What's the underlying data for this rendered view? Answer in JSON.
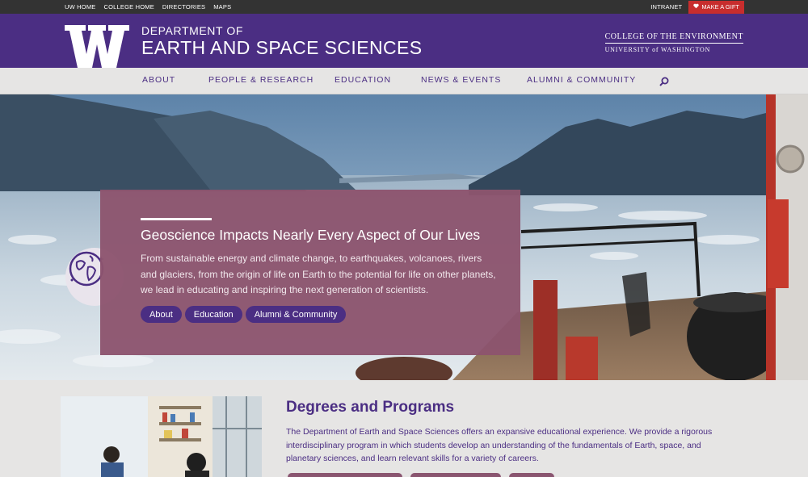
{
  "utility": {
    "links": [
      "UW HOME",
      "COLLEGE HOME",
      "DIRECTORIES",
      "MAPS"
    ],
    "intranet": "INTRANET",
    "gift": "MAKE A GIFT"
  },
  "header": {
    "dept_line1": "DEPARTMENT OF",
    "dept_line2": "EARTH AND SPACE SCIENCES",
    "college_line1": "COLLEGE OF THE ENVIRONMENT",
    "college_line2": "UNIVERSITY of WASHINGTON"
  },
  "nav": {
    "items": [
      "ABOUT",
      "PEOPLE & RESEARCH",
      "EDUCATION",
      "NEWS & EVENTS",
      "ALUMNI & COMMUNITY"
    ]
  },
  "hero": {
    "title": "Geoscience Impacts Nearly Every Aspect of Our Lives",
    "body": "From sustainable energy and climate change, to earthquakes, volcanoes, rivers and glaciers, from the origin of life on Earth to the potential for life on other planets, we lead in educating and inspiring the next generation of scientists.",
    "buttons": [
      "About",
      "Education",
      "Alumni & Community"
    ]
  },
  "degrees": {
    "title": "Degrees and Programs",
    "body": "The Department of Earth and Space Sciences offers an expansive educational experience. We provide a rigorous interdisciplinary program in which students develop an understanding of the fundamentals of Earth, space, and planetary sciences, and learn relevant skills for a variety of careers."
  },
  "colors": {
    "uw_purple": "#4b2e83",
    "card_mauve": "#8c546e",
    "gift_red": "#c72d2d",
    "utility_bg": "#333333"
  },
  "icons": [
    "heart-icon",
    "search-icon",
    "globe-icon"
  ]
}
